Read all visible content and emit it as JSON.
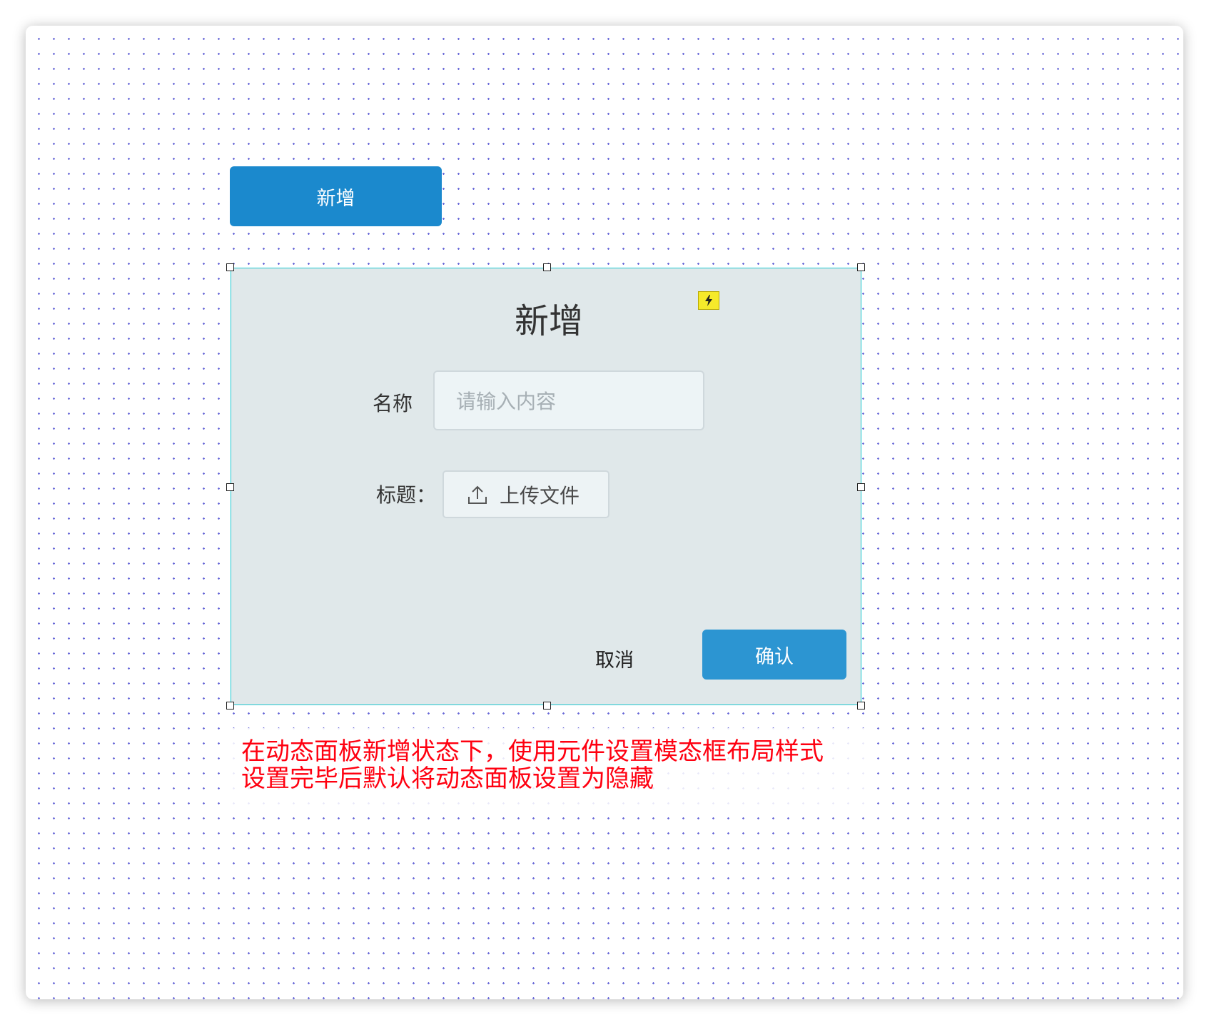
{
  "page": {
    "primary_button_label": "新增"
  },
  "panel": {
    "title": "新增",
    "interaction_icon": "lightning-icon",
    "name_label": "名称",
    "name_placeholder": "请输入内容",
    "title_label": "标题：",
    "upload_label": "上传文件",
    "upload_icon": "upload-icon",
    "cancel_label": "取消",
    "confirm_label": "确认"
  },
  "annotation": {
    "line1": "在动态面板新增状态下，使用元件设置模态框布局样式",
    "line2": "设置完毕后默认将动态面板设置为隐藏"
  },
  "colors": {
    "primary": "#1b89cd",
    "confirm": "#2c95d2",
    "panel_bg": "#e0e8ea",
    "selection_border": "#1ec8d0",
    "annotation_text": "#ff0010",
    "grid_dots": "#6a6ad8"
  }
}
